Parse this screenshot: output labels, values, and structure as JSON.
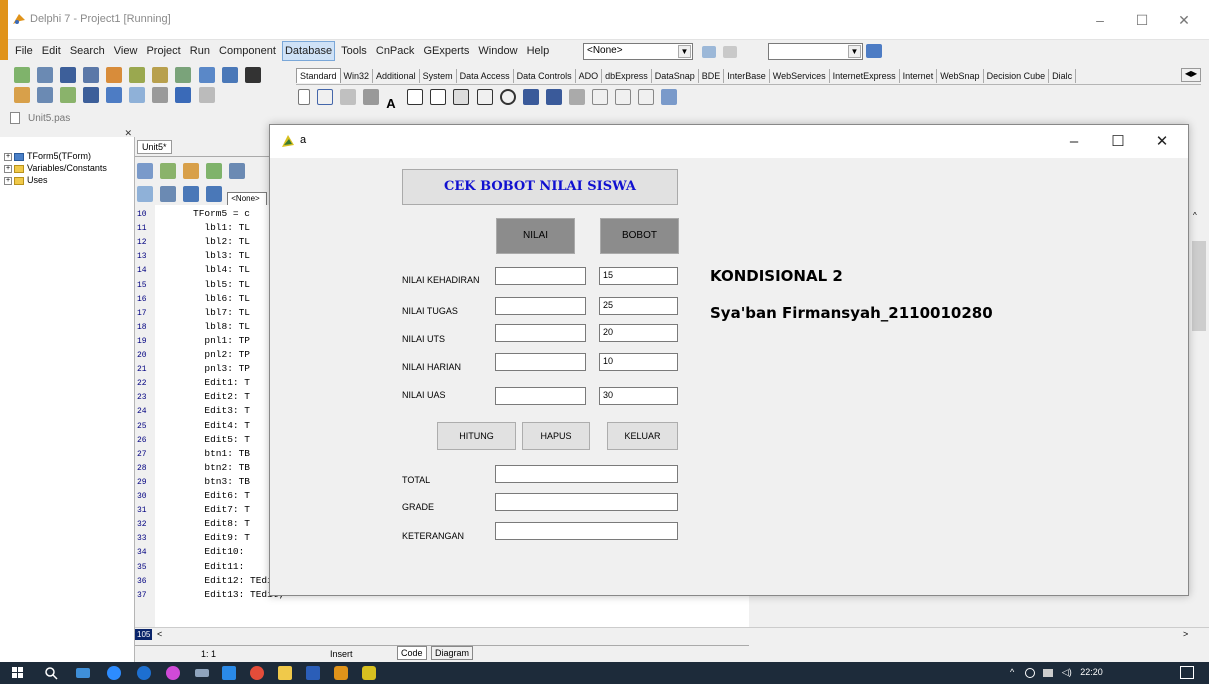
{
  "ide": {
    "title": "Delphi 7 - Project1 [Running]",
    "menu": [
      "File",
      "Edit",
      "Search",
      "View",
      "Project",
      "Run",
      "Component",
      "Database",
      "Tools",
      "CnPack",
      "GExperts",
      "Window",
      "Help"
    ],
    "active_menu": "Database",
    "combo1": "<None>",
    "palette_tabs": [
      "Standard",
      "Win32",
      "Additional",
      "System",
      "Data Access",
      "Data Controls",
      "ADO",
      "dbExpress",
      "DataSnap",
      "BDE",
      "InterBase",
      "WebServices",
      "InternetExpress",
      "Internet",
      "WebSnap",
      "Decision Cube",
      "Dialc"
    ],
    "unit_tab_title": "Unit5.pas",
    "editor_tab": "Unit5*",
    "combo2": "<None>",
    "tree": [
      "TForm5(TForm)",
      "Variables/Constants",
      "Uses"
    ],
    "code_lines": [
      {
        "n": "10",
        "t": "TForm5 = c"
      },
      {
        "n": "11",
        "t": "  lbl1: TL"
      },
      {
        "n": "12",
        "t": "  lbl2: TL"
      },
      {
        "n": "13",
        "t": "  lbl3: TL"
      },
      {
        "n": "14",
        "t": "  lbl4: TL"
      },
      {
        "n": "15",
        "t": "  lbl5: TL"
      },
      {
        "n": "16",
        "t": "  lbl6: TL"
      },
      {
        "n": "17",
        "t": "  lbl7: TL"
      },
      {
        "n": "18",
        "t": "  lbl8: TL"
      },
      {
        "n": "19",
        "t": "  pnl1: TP"
      },
      {
        "n": "20",
        "t": "  pnl2: TP"
      },
      {
        "n": "21",
        "t": "  pnl3: TP"
      },
      {
        "n": "22",
        "t": "  Edit1: T"
      },
      {
        "n": "23",
        "t": "  Edit2: T"
      },
      {
        "n": "24",
        "t": "  Edit3: T"
      },
      {
        "n": "25",
        "t": "  Edit4: T"
      },
      {
        "n": "26",
        "t": "  Edit5: T"
      },
      {
        "n": "27",
        "t": "  btn1: TB"
      },
      {
        "n": "28",
        "t": "  btn2: TB"
      },
      {
        "n": "29",
        "t": "  btn3: TB"
      },
      {
        "n": "30",
        "t": "  Edit6: T"
      },
      {
        "n": "31",
        "t": "  Edit7: T"
      },
      {
        "n": "32",
        "t": "  Edit8: T"
      },
      {
        "n": "33",
        "t": "  Edit9: T"
      },
      {
        "n": "34",
        "t": "  Edit10:"
      },
      {
        "n": "35",
        "t": "  Edit11:"
      },
      {
        "n": "36",
        "t": "  Edit12: TEdit;"
      },
      {
        "n": "37",
        "t": "  Edit13: TEdit;"
      }
    ],
    "status_pos": "1: 1",
    "status_mode": "Insert",
    "bottom_tabs": [
      "Code",
      "Diagram"
    ],
    "line_badge": "105"
  },
  "form": {
    "title": "a",
    "heading": "CEK BOBOT NILAI SISWA",
    "col_nilai": "NILAI",
    "col_bobot": "BOBOT",
    "rows": [
      {
        "label": "NILAI KEHADIRAN",
        "nilai": "",
        "bobot": "15"
      },
      {
        "label": "NILAI TUGAS",
        "nilai": "",
        "bobot": "25"
      },
      {
        "label": "NILAI UTS",
        "nilai": "",
        "bobot": "20"
      },
      {
        "label": "NILAI HARIAN",
        "nilai": "",
        "bobot": "10"
      },
      {
        "label": "NILAI UAS",
        "nilai": "",
        "bobot": "30"
      }
    ],
    "btn_hitung": "HITUNG",
    "btn_hapus": "HAPUS",
    "btn_keluar": "KELUAR",
    "label_total": "TOTAL",
    "label_grade": "GRADE",
    "label_keterangan": "KETERANGAN",
    "total": "",
    "grade": "",
    "keterangan": "",
    "caption1": "KONDISIONAL 2",
    "caption2": "Sya'ban Firmansyah_2110010280"
  },
  "taskbar": {
    "time": "22:20",
    "icons": [
      "windows-icon",
      "search-icon",
      "desktop-icon",
      "zoom-icon",
      "media-icon",
      "browser-icon",
      "keyboard-icon",
      "vscode-icon",
      "chrome-icon",
      "explorer-icon",
      "word-icon",
      "delphi-icon",
      "running-app-icon"
    ]
  },
  "colors": {
    "heading_text": "#1010d0",
    "taskbar": "#1d2b3a",
    "header_panel": "#8c8c8c"
  }
}
